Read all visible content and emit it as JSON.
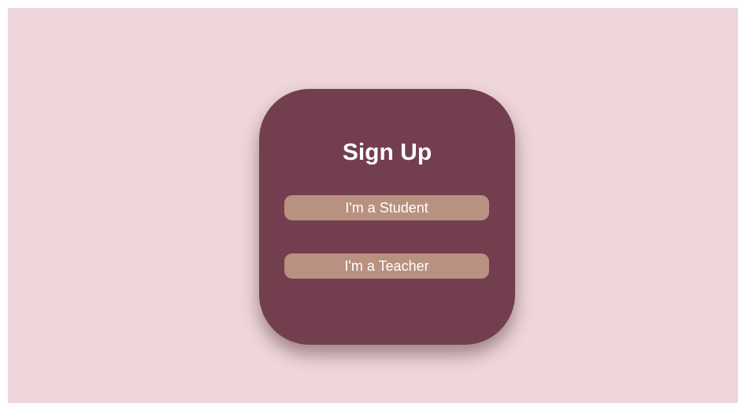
{
  "signup": {
    "title": "Sign Up",
    "student_label": "I'm a Student",
    "teacher_label": "I'm a Teacher"
  },
  "colors": {
    "background": "#efd6da",
    "card": "#733f4f",
    "button": "#b89180",
    "text": "#ffffff"
  }
}
